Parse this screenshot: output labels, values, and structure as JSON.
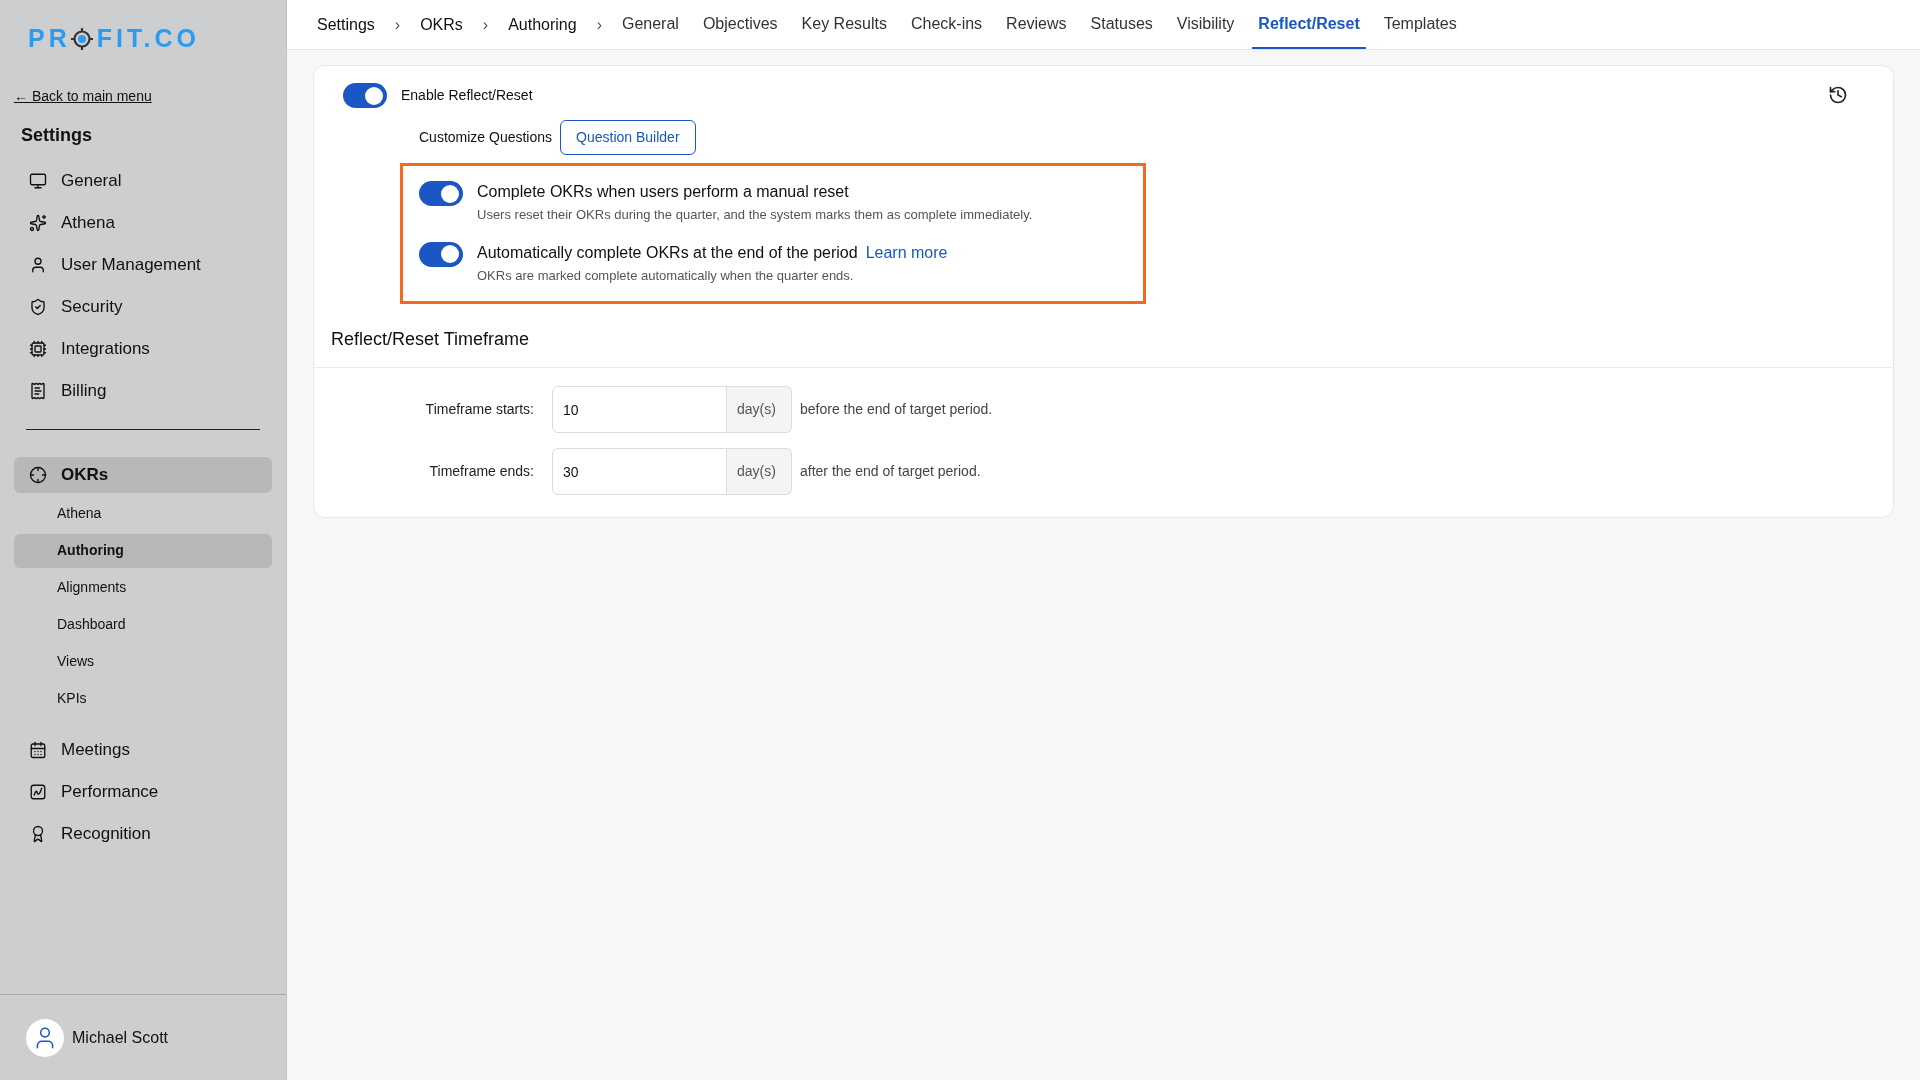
{
  "logo": {
    "before": "PR",
    "after": "FIT.CO"
  },
  "sidebar": {
    "back_link": "← Back to main menu",
    "title": "Settings",
    "items": [
      {
        "label": "General",
        "selected": false
      },
      {
        "label": "Athena",
        "selected": false
      },
      {
        "label": "User Management",
        "selected": false
      },
      {
        "label": "Security",
        "selected": false
      },
      {
        "label": "Integrations",
        "selected": false
      },
      {
        "label": "Billing",
        "selected": false
      }
    ],
    "okrs": {
      "label": "OKRs",
      "selected": true,
      "children": [
        {
          "label": "Athena",
          "selected": false
        },
        {
          "label": "Authoring",
          "selected": true
        },
        {
          "label": "Alignments",
          "selected": false
        },
        {
          "label": "Dashboard",
          "selected": false
        },
        {
          "label": "Views",
          "selected": false
        },
        {
          "label": "KPIs",
          "selected": false
        }
      ]
    },
    "more_items": [
      {
        "label": "Meetings",
        "selected": false
      },
      {
        "label": "Performance",
        "selected": false
      },
      {
        "label": "Recognition",
        "selected": false
      }
    ],
    "user": {
      "name": "Michael Scott"
    }
  },
  "breadcrumb": [
    "Settings",
    "OKRs",
    "Authoring"
  ],
  "breadcrumb_separator": "›",
  "tabs": [
    {
      "label": "General",
      "selected": false
    },
    {
      "label": "Objectives",
      "selected": false
    },
    {
      "label": "Key Results",
      "selected": false
    },
    {
      "label": "Check-ins",
      "selected": false
    },
    {
      "label": "Reviews",
      "selected": false
    },
    {
      "label": "Statuses",
      "selected": false
    },
    {
      "label": "Visibility",
      "selected": false
    },
    {
      "label": "Reflect/Reset",
      "selected": true
    },
    {
      "label": "Templates",
      "selected": false
    }
  ],
  "enable": {
    "label": "Enable Reflect/Reset",
    "on": true
  },
  "customize": {
    "label": "Customize Questions",
    "button": "Question Builder"
  },
  "options": [
    {
      "title": "Complete OKRs when users perform a manual reset",
      "description": "Users reset their OKRs during the quarter, and the system marks them as complete immediately.",
      "on": true
    },
    {
      "title": "Automatically complete OKRs at the end of the period",
      "link": "Learn more",
      "description": "OKRs are marked complete automatically when the quarter ends.",
      "on": true
    }
  ],
  "timeframe": {
    "heading": "Reflect/Reset Timeframe",
    "fields": [
      {
        "label": "Timeframe starts:",
        "value": "10",
        "unit": "day(s)",
        "suffix": "before the end of target period."
      },
      {
        "label": "Timeframe ends:",
        "value": "30",
        "unit": "day(s)",
        "suffix": "after the end of target period."
      }
    ]
  }
}
